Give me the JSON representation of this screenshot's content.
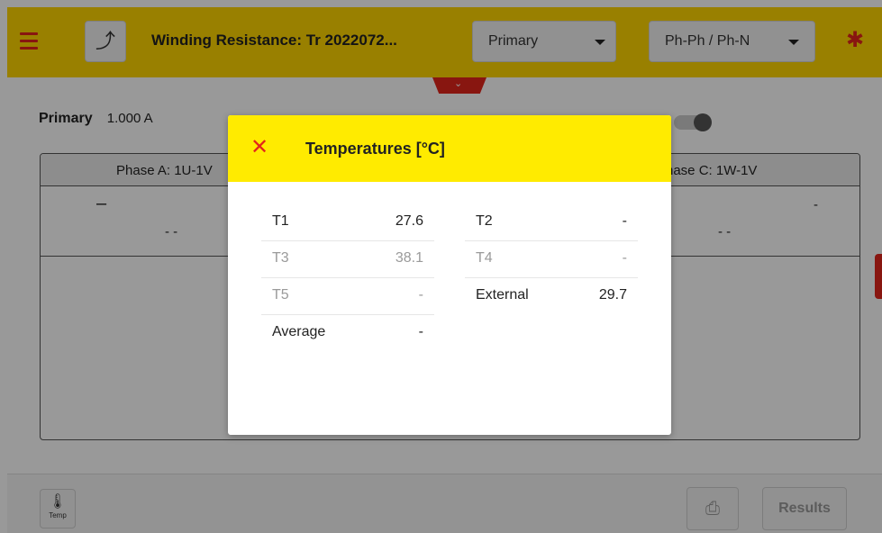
{
  "header": {
    "title": "Winding Resistance: Tr 2022072...",
    "up_button_glyph": "⤴",
    "dropdown_primary": "Primary",
    "dropdown_phase": "Ph-Ph / Ph-N",
    "colors": {
      "accent": "#ffd500",
      "brand_red": "#e3261b"
    }
  },
  "background": {
    "primary_label": "Primary",
    "primary_value": "1.000 A",
    "phase_a": "Phase A: 1U-1V",
    "phase_c": "hase C: 1W-1V",
    "dash": "–",
    "dashes": "-   -",
    "dash_small": "-"
  },
  "footer": {
    "temp_label": "Temp",
    "results_label": "Results"
  },
  "modal": {
    "title": "Temperatures [°C]",
    "close_glyph": "✕",
    "left": [
      {
        "key": "T1",
        "value": "27.6"
      },
      {
        "key": "T3",
        "value": "38.1"
      },
      {
        "key": "T5",
        "value": "-"
      },
      {
        "key": "Average",
        "value": "-"
      }
    ],
    "right": [
      {
        "key": "T2",
        "value": "-"
      },
      {
        "key": "T4",
        "value": "-"
      },
      {
        "key": "External",
        "value": "29.7"
      }
    ]
  }
}
